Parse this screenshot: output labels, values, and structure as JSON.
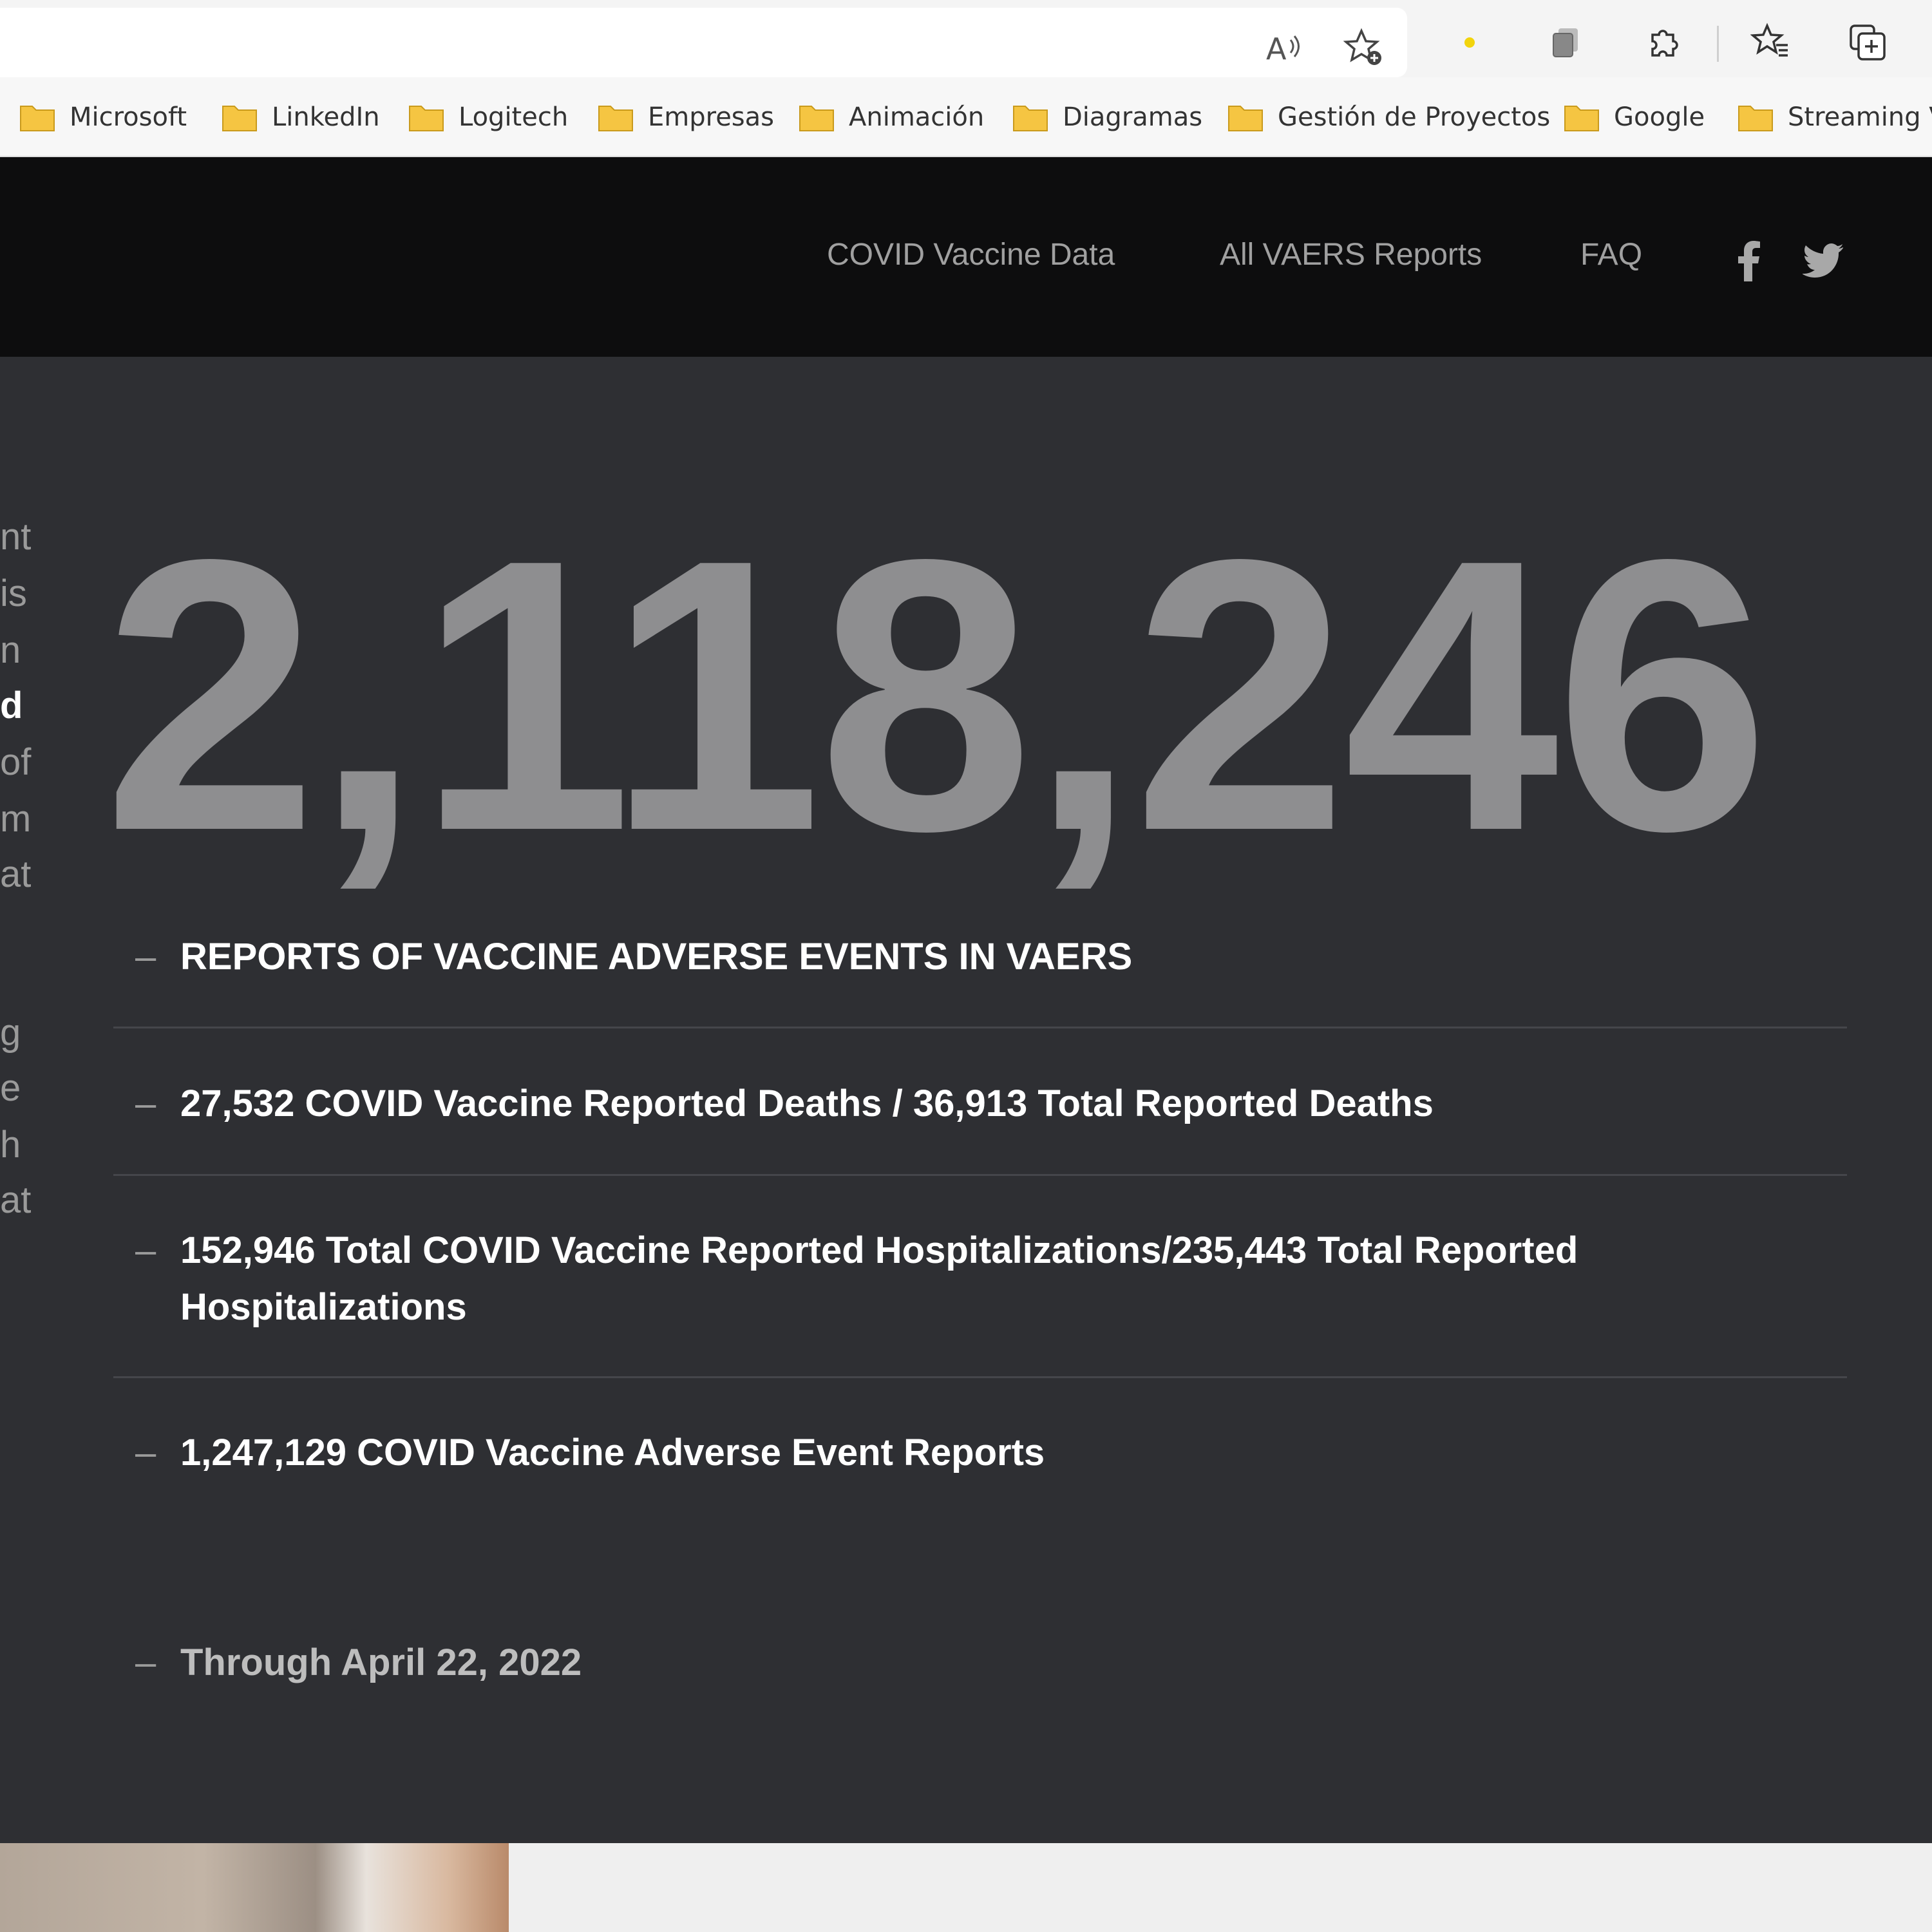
{
  "browser": {
    "bookmarks": [
      "Microsoft",
      "LinkedIn",
      "Logitech",
      "Empresas",
      "Animación",
      "Diagramas",
      "Gestión de Proyectos",
      "Google",
      "Streaming V"
    ]
  },
  "site": {
    "nav": [
      "COVID Vaccine Data",
      "All VAERS Reports",
      "FAQ"
    ]
  },
  "hero": {
    "side_text_fragments": [
      "nt",
      "is",
      "n",
      "d",
      "of",
      "m",
      "at",
      "g",
      "e",
      "h",
      "at"
    ],
    "big_number": "2,118,246",
    "dash": "–",
    "stats": [
      "REPORTS OF VACCINE ADVERSE EVENTS IN VAERS",
      "27,532 COVID Vaccine Reported Deaths / 36,913 Total Reported Deaths",
      "152,946 Total COVID Vaccine Reported Hospitalizations/235,443 Total Reported Hospitalizations",
      "1,247,129 COVID Vaccine Adverse Event Reports"
    ],
    "through_date": "Through April 22, 2022"
  },
  "colors": {
    "header_bg": "#0d0d0e",
    "hero_bg": "#2e2f33",
    "big_number": "#8e8e90",
    "folder": "#f5c542"
  },
  "icons": [
    "read-aloud-icon",
    "add-favorite-icon",
    "status-dot-icon",
    "collections-icon",
    "extensions-icon",
    "favorites-icon",
    "add-tab-icon",
    "facebook-icon",
    "twitter-icon",
    "folder-icon"
  ]
}
